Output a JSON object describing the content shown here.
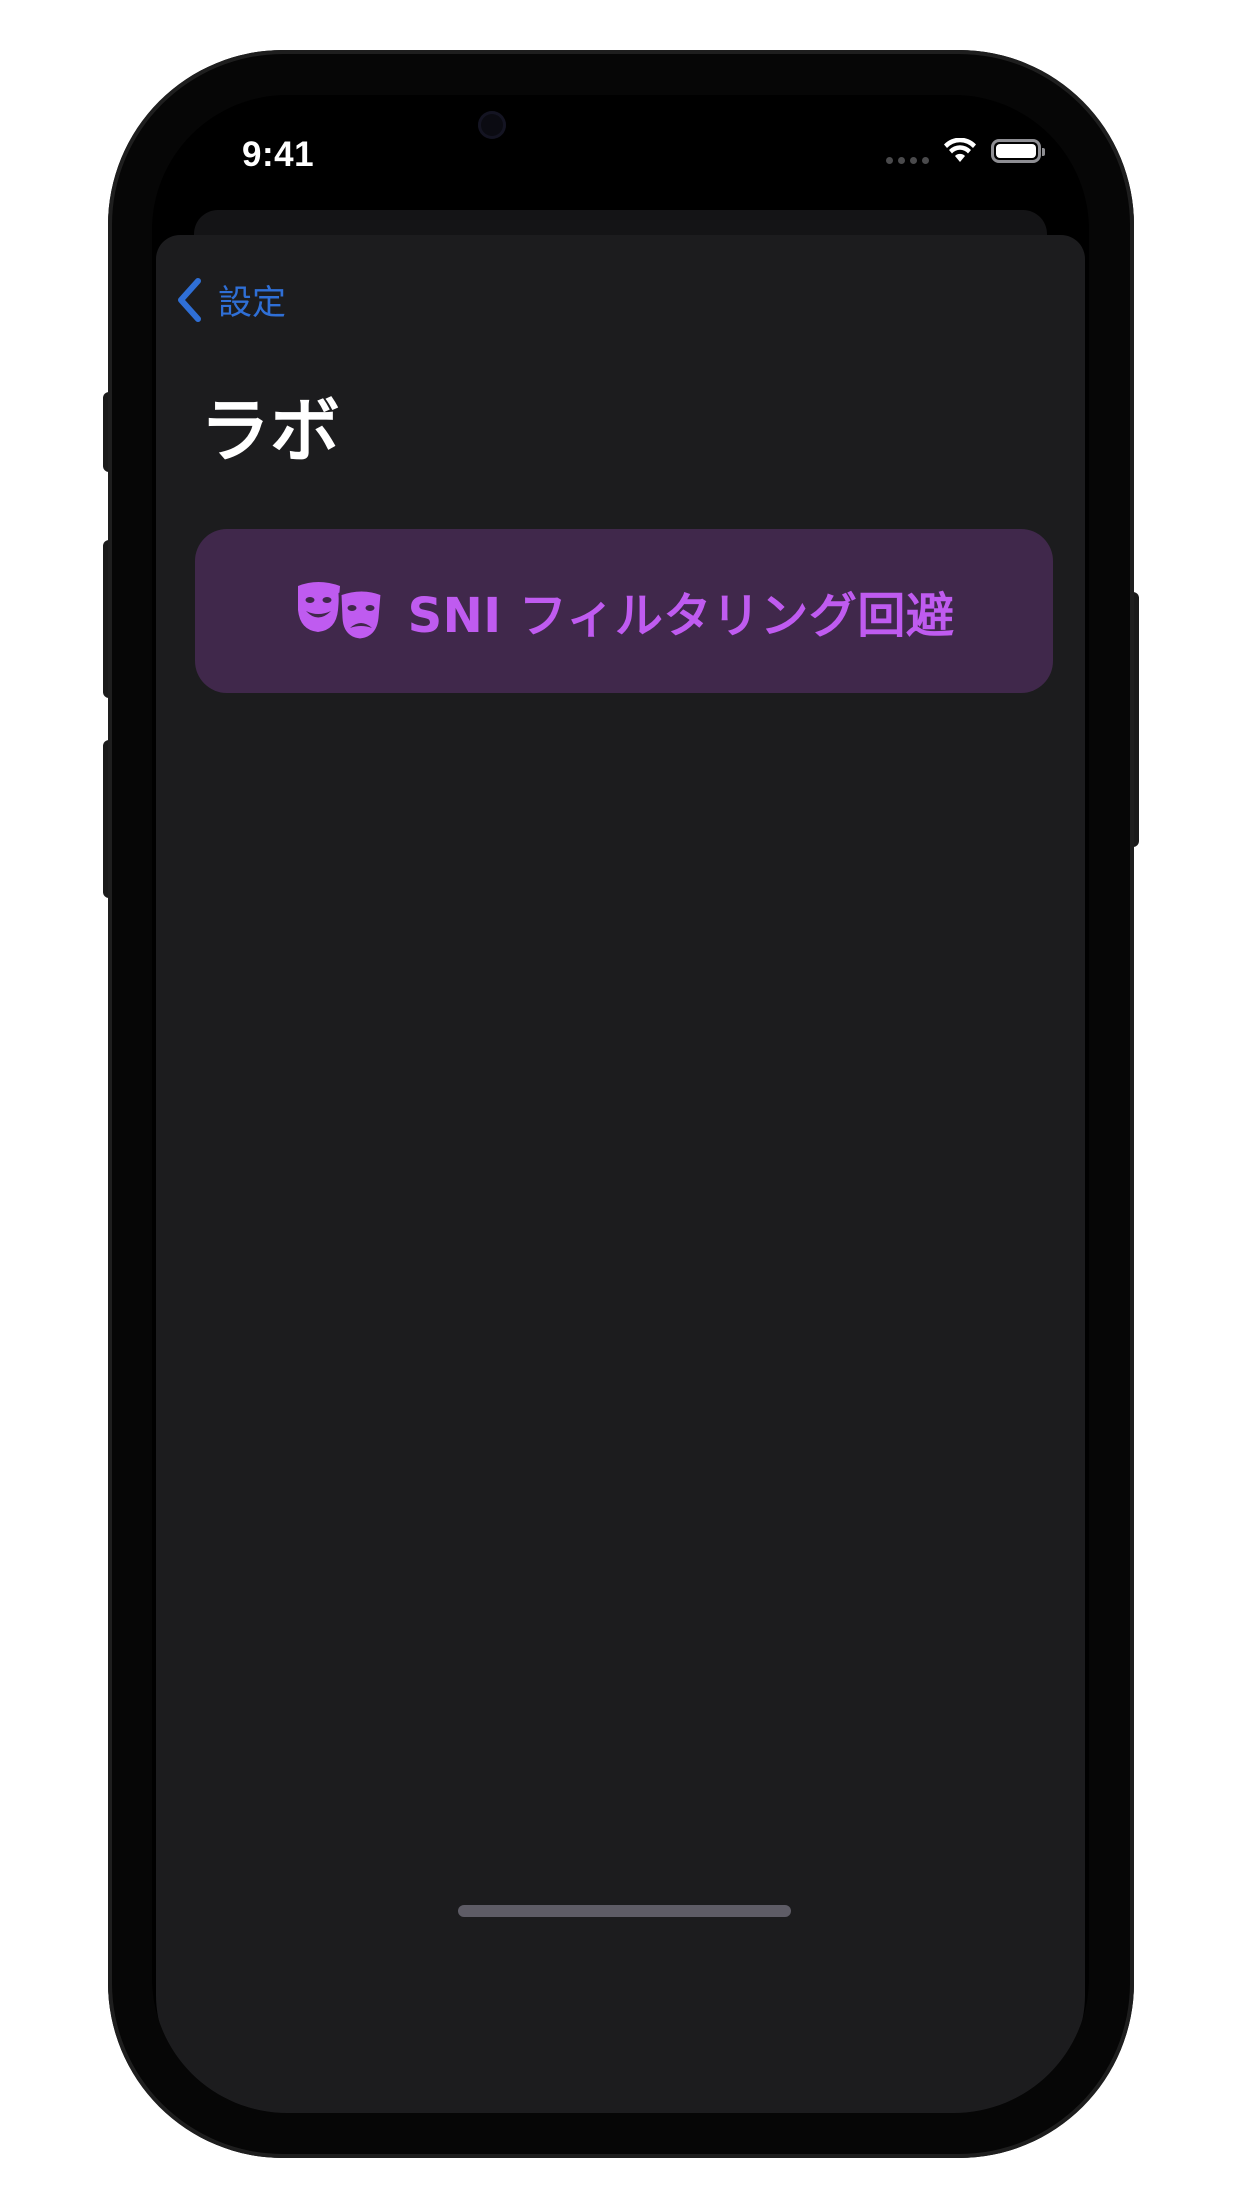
{
  "status_bar": {
    "time": "9:41"
  },
  "nav": {
    "back_label": "設定",
    "back_icon": "chevron-left-icon"
  },
  "page": {
    "title": "ラボ"
  },
  "actions": {
    "sni_button_label": "SNI フィルタリング回避",
    "sni_button_icon": "theater-masks-icon"
  },
  "colors": {
    "accent_blue": "#2f6fd6",
    "button_background": "#40284b",
    "button_text": "#bf5bf0",
    "sheet_background": "#1c1c1e"
  }
}
